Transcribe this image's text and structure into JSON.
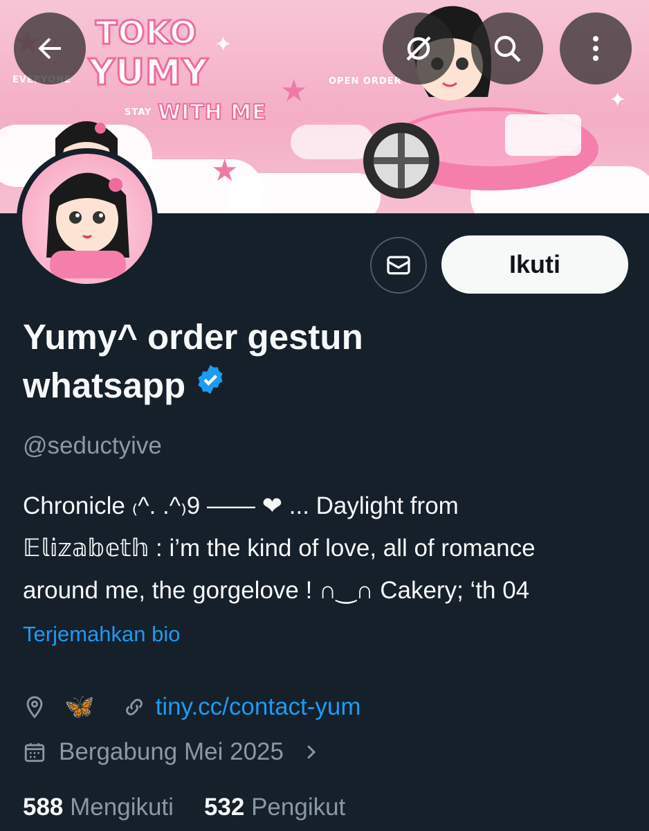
{
  "banner": {
    "logo_line1": "TOKO",
    "logo_line2": "YUMY",
    "tag_everyone": "EVERYONE",
    "tag_stay": "STAY",
    "tag_with_me": "WITH ME",
    "tag_open_order": "OPEN ORDER"
  },
  "nav": {
    "back_icon": "arrow-left-icon",
    "mute_icon": "slashed-bell-icon",
    "search_icon": "search-icon",
    "more_icon": "more-vertical-icon"
  },
  "actions": {
    "message_icon": "envelope-icon",
    "follow_label": "Ikuti"
  },
  "profile": {
    "name_line1": "Yumy^ order gestun",
    "name_line2": "whatsapp",
    "handle": "@seductyive",
    "bio_line1": "Chronicle ₍^. .^₎9 —— ❤ ... Daylight from",
    "bio_line2": "𝔼𝕝𝕚𝕫𝕒𝕓𝕖𝕥𝕙 : i’m the kind of love, all of romance",
    "bio_line3": "around me, the gorgelove ! ∩‿∩ Cakery; ‘th 04",
    "translate_label": "Terjemahkan bio",
    "location": "🦋",
    "website": "tiny.cc/contact-yum",
    "joined": "Bergabung Mei 2025",
    "following_count": "588",
    "following_label": "Mengikuti",
    "followers_count": "532",
    "followers_label": "Pengikut"
  },
  "colors": {
    "background": "#15202b",
    "accent": "#1d9bf0",
    "banner_pink": "#f4aec6",
    "muted_text": "#8b98a5"
  }
}
